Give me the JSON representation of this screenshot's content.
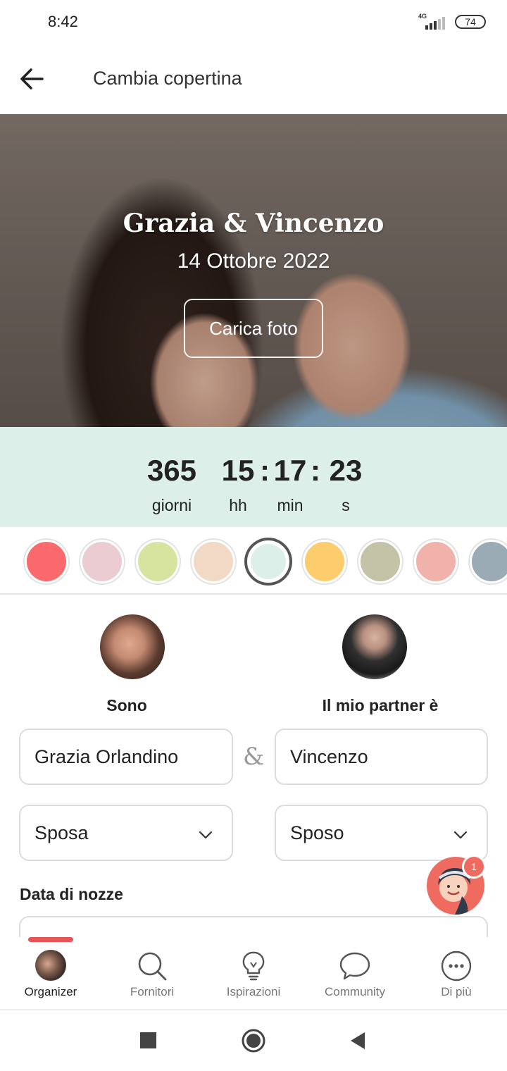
{
  "status": {
    "time": "8:42",
    "network": "4G",
    "battery": "74"
  },
  "header": {
    "title": "Cambia copertina"
  },
  "cover": {
    "names": "Grazia & Vincenzo",
    "date": "14 Ottobre 2022",
    "upload_label": "Carica foto"
  },
  "countdown": {
    "days": "365",
    "hours": "15",
    "minutes": "17",
    "seconds": "23",
    "separator": ":",
    "days_label": "giorni",
    "hours_label": "hh",
    "minutes_label": "min",
    "seconds_label": "s"
  },
  "color_swatches": [
    "#fa6a6d",
    "#ebcdd1",
    "#d6e4a0",
    "#f2d9c6",
    "#dcefe9",
    "#fdcd6d",
    "#c3c3a8",
    "#f0b2aa",
    "#9aabb6"
  ],
  "selected_swatch": "#dcefe9",
  "partners": {
    "me_label": "Sono",
    "partner_label": "Il mio partner è",
    "me_name": "Grazia Orlandino",
    "partner_name": "Vincenzo",
    "ampersand": "&",
    "me_role": "Sposa",
    "partner_role": "Sposo"
  },
  "wedding_date": {
    "label": "Data di nozze"
  },
  "assistant": {
    "badge_count": "1"
  },
  "bottom_nav": {
    "items": [
      {
        "label": "Organizer",
        "icon": "avatar-icon",
        "active": true
      },
      {
        "label": "Fornitori",
        "icon": "search-icon",
        "active": false
      },
      {
        "label": "Ispirazioni",
        "icon": "lightbulb-icon",
        "active": false
      },
      {
        "label": "Community",
        "icon": "chat-bubble-icon",
        "active": false
      },
      {
        "label": "Di più",
        "icon": "more-icon",
        "active": false
      }
    ]
  },
  "system_nav": [
    "recents-icon",
    "home-icon",
    "back-icon"
  ]
}
